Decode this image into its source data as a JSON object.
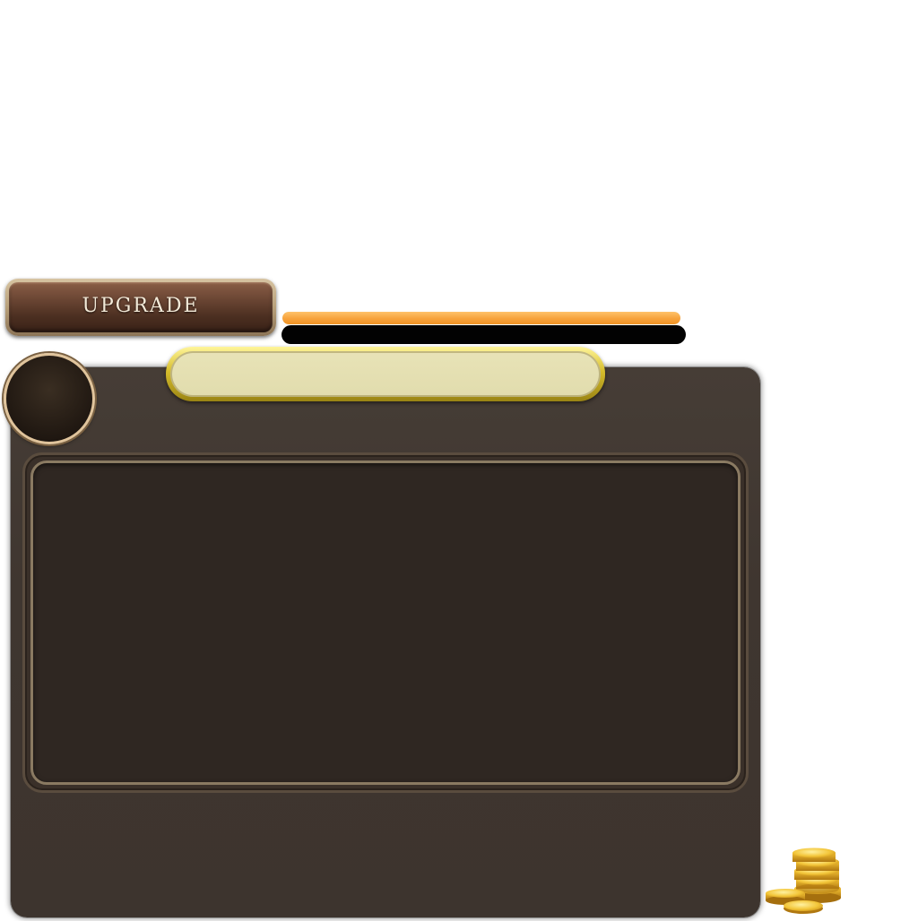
{
  "upgrade_button": {
    "label": "UPGRADE"
  },
  "progress": {
    "orange_fill": 1.0
  },
  "colors": {
    "panel": "#3f3630",
    "inner": "#2f2722",
    "title_plate_border": "#d6bd2c",
    "title_plate_fill": "#e1dcad",
    "progress_orange": "#f7a23b",
    "button": "#5a3a2a"
  },
  "icons": {
    "avatar": "avatar-frame",
    "coins": "gold-coins-icon"
  }
}
